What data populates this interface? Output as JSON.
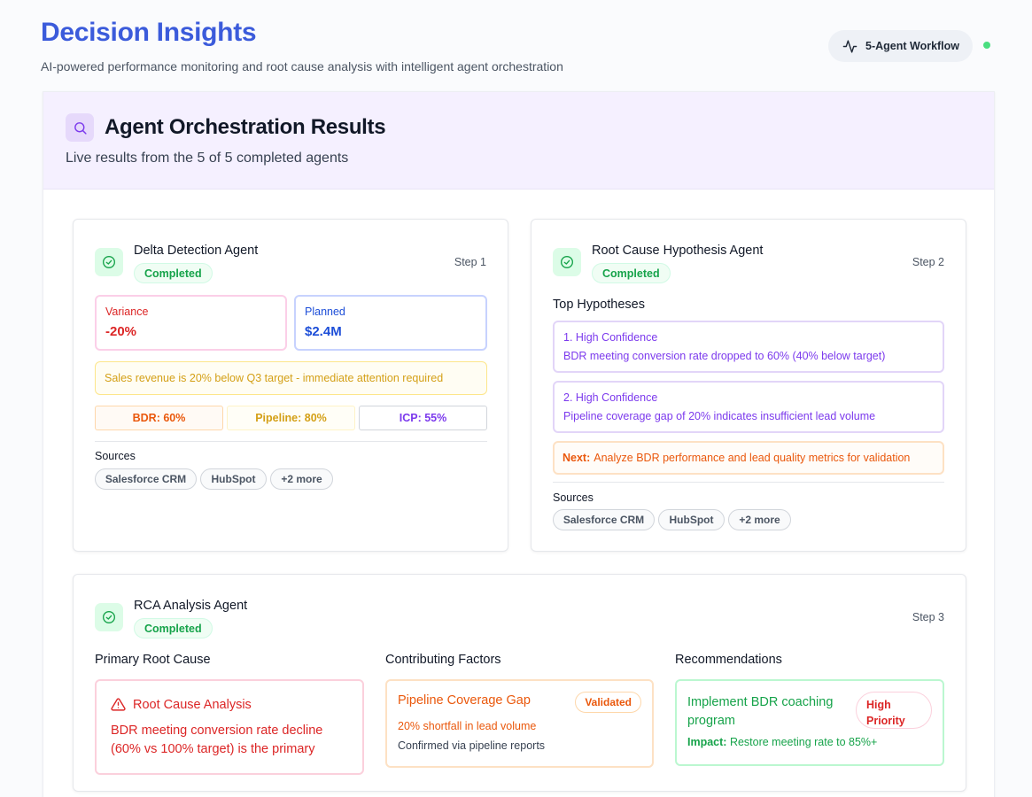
{
  "header": {
    "title": "Decision Insights",
    "subtitle": "AI-powered performance monitoring and root cause analysis with intelligent agent orchestration",
    "workflow_label": "5-Agent Workflow"
  },
  "panel": {
    "title": "Agent Orchestration Results",
    "subtitle": "Live results from the 5 of 5 completed agents"
  },
  "colors": {
    "accent": "#3b5bdb",
    "success": "#16a34a",
    "danger": "#dc2626",
    "warning": "#ea580c",
    "purple": "#7c3aed"
  },
  "delta_agent": {
    "name": "Delta Detection Agent",
    "status": "Completed",
    "step": "Step 1",
    "variance_label": "Variance",
    "variance_value": "-20%",
    "planned_label": "Planned",
    "planned_value": "$2.4M",
    "alert": "Sales revenue is 20% below Q3 target - immediate attention required",
    "chips": [
      "BDR: 60%",
      "Pipeline: 80%",
      "ICP: 55%"
    ],
    "sources_label": "Sources",
    "sources": [
      "Salesforce CRM",
      "HubSpot",
      "+2 more"
    ]
  },
  "hypothesis_agent": {
    "name": "Root Cause Hypothesis Agent",
    "status": "Completed",
    "step": "Step 2",
    "section_title": "Top Hypotheses",
    "hypotheses": [
      {
        "title": "1. High Confidence",
        "text": "BDR meeting conversion rate dropped to 60% (40% below target)"
      },
      {
        "title": "2. High Confidence",
        "text": "Pipeline coverage gap of 20% indicates insufficient lead volume"
      }
    ],
    "next_label": "Next:",
    "next_text": "Analyze BDR performance and lead quality metrics for validation",
    "sources_label": "Sources",
    "sources": [
      "Salesforce CRM",
      "HubSpot",
      "+2 more"
    ]
  },
  "rca_agent": {
    "name": "RCA Analysis Agent",
    "status": "Completed",
    "step": "Step 3",
    "primary_title": "Primary Root Cause",
    "primary_heading": "Root Cause Analysis",
    "primary_text": "BDR meeting conversion rate decline (60% vs 100% target) is the primary",
    "factors_title": "Contributing Factors",
    "factor_name": "Pipeline Coverage Gap",
    "factor_badge": "Validated",
    "factor_line1": "20% shortfall in lead volume",
    "factor_line2": "Confirmed via pipeline reports",
    "rec_title": "Recommendations",
    "rec_name": "Implement BDR coaching program",
    "rec_priority": "High Priority",
    "rec_impact_label": "Impact:",
    "rec_impact_text": "Restore meeting rate to 85%+"
  }
}
